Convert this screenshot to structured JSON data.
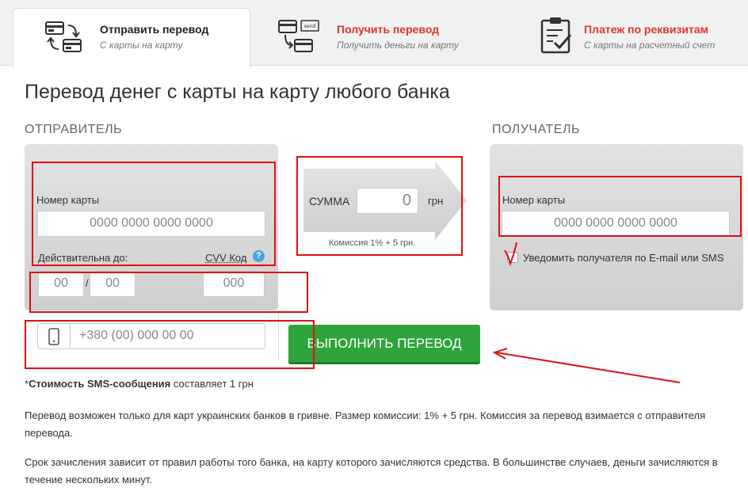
{
  "tabs": [
    {
      "title": "Отправить перевод",
      "subtitle": "С карты на карту"
    },
    {
      "title": "Получить перевод",
      "subtitle": "Получить деньги на карту"
    },
    {
      "title": "Платеж по реквизитам",
      "subtitle": "С карты на расчетный счет"
    }
  ],
  "page_title": "Перевод денег с карты на карту любого банка",
  "sender": {
    "label": "ОТПРАВИТЕЛЬ",
    "card_label": "Номер карты",
    "card_placeholder": "0000 0000 0000 0000",
    "valid_label": "Действительна до:",
    "month_placeholder": "00",
    "year_placeholder": "00",
    "slash": "/",
    "cvv_label": "CVV Код",
    "cvv_help": "?",
    "cvv_placeholder": "000",
    "phone_placeholder": "+380 (00) 000 00 00"
  },
  "amount": {
    "label": "СУММА",
    "value": "0",
    "currency": "грн",
    "commission": "Комиссия 1% + 5 грн."
  },
  "recipient": {
    "label": "ПОЛУЧАТЕЛЬ",
    "card_label": "Номер карты",
    "card_placeholder": "0000 0000 0000 0000",
    "notify_label": "Уведомить получателя по E-mail или SMS",
    "notify_checked": true
  },
  "submit_label": "ВЫПОЛНИТЬ ПЕРЕВОД",
  "sms_note": {
    "prefix": "*",
    "bold": "Стоимость SMS-сообщения",
    "rest": " составляет 1 грн"
  },
  "info_1": "Перевод возможен только для карт украинских банков в гривне. Размер комиссии: 1% + 5 грн. Комиссия за перевод взимается с отправителя перевода.",
  "info_2": "Срок зачисления зависит от правил работы того банка, на карту которого зачисляются средства. В большинстве случаев, деньги зачисляются в течение нескольких минут.",
  "colors": {
    "accent_red": "#e0332f",
    "button_green": "#2ea43b",
    "annotation_red": "#e01010",
    "help_blue": "#4aa3df"
  }
}
